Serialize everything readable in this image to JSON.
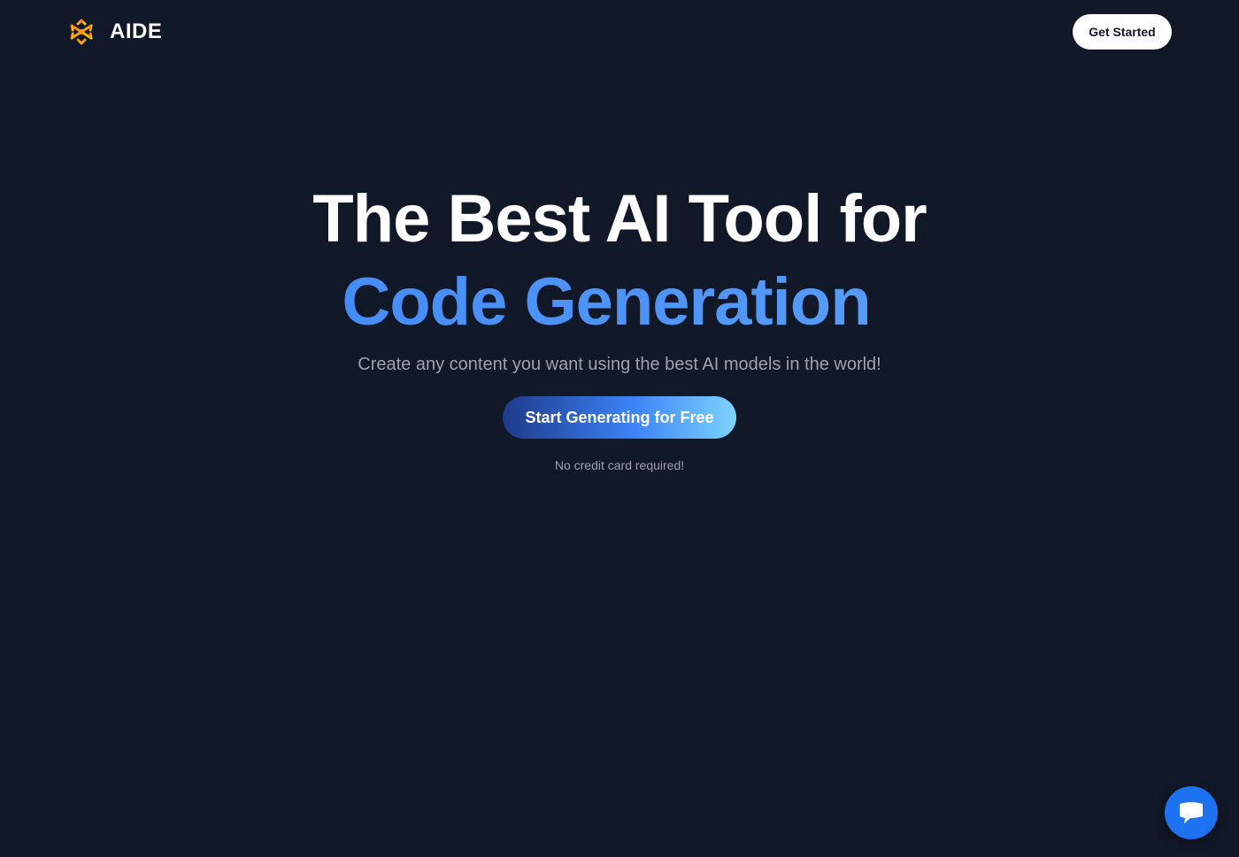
{
  "header": {
    "brand_name": "AIDE",
    "logo_icon": "snowflake-logo-icon",
    "get_started_label": "Get Started"
  },
  "hero": {
    "headline_line1": "The Best AI Tool for",
    "headline_line2": "Code Generation",
    "subtitle": "Create any content you want using the best AI models in the world!",
    "cta_label": "Start Generating for Free",
    "note": "No credit card required!"
  },
  "chat_widget": {
    "icon": "chat-bubble-icon"
  },
  "colors": {
    "background": "#111827",
    "accent_blue": "#3b82f6",
    "accent_light_blue": "#60a5fa",
    "logo_orange": "#f59e0b",
    "chat_blue": "#1d72f2"
  }
}
